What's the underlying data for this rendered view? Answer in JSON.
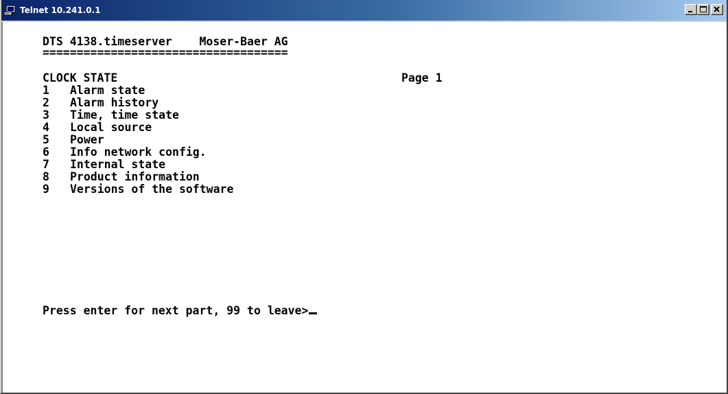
{
  "window": {
    "title": "Telnet 10.241.0.1"
  },
  "terminal": {
    "header": "DTS 4138.timeserver    Moser-Baer AG",
    "separator": "====================================",
    "section_title": "CLOCK STATE",
    "page_label": "Page 1",
    "menu_items": [
      {
        "num": "1",
        "label": "Alarm state"
      },
      {
        "num": "2",
        "label": "Alarm history"
      },
      {
        "num": "3",
        "label": "Time, time state"
      },
      {
        "num": "4",
        "label": "Local source"
      },
      {
        "num": "5",
        "label": "Power"
      },
      {
        "num": "6",
        "label": "Info network config."
      },
      {
        "num": "7",
        "label": "Internal state"
      },
      {
        "num": "8",
        "label": "Product information"
      },
      {
        "num": "9",
        "label": "Versions of the software"
      }
    ],
    "prompt": "Press enter for next part, 99 to leave>"
  },
  "icons": {
    "app": "telnet-icon",
    "minimize": "minimize-icon",
    "maximize": "maximize-icon",
    "close": "close-icon"
  },
  "colors": {
    "titlebar_start": "#0a246a",
    "titlebar_end": "#a6caf0",
    "terminal_bg": "#ffffff",
    "terminal_fg": "#000000"
  }
}
